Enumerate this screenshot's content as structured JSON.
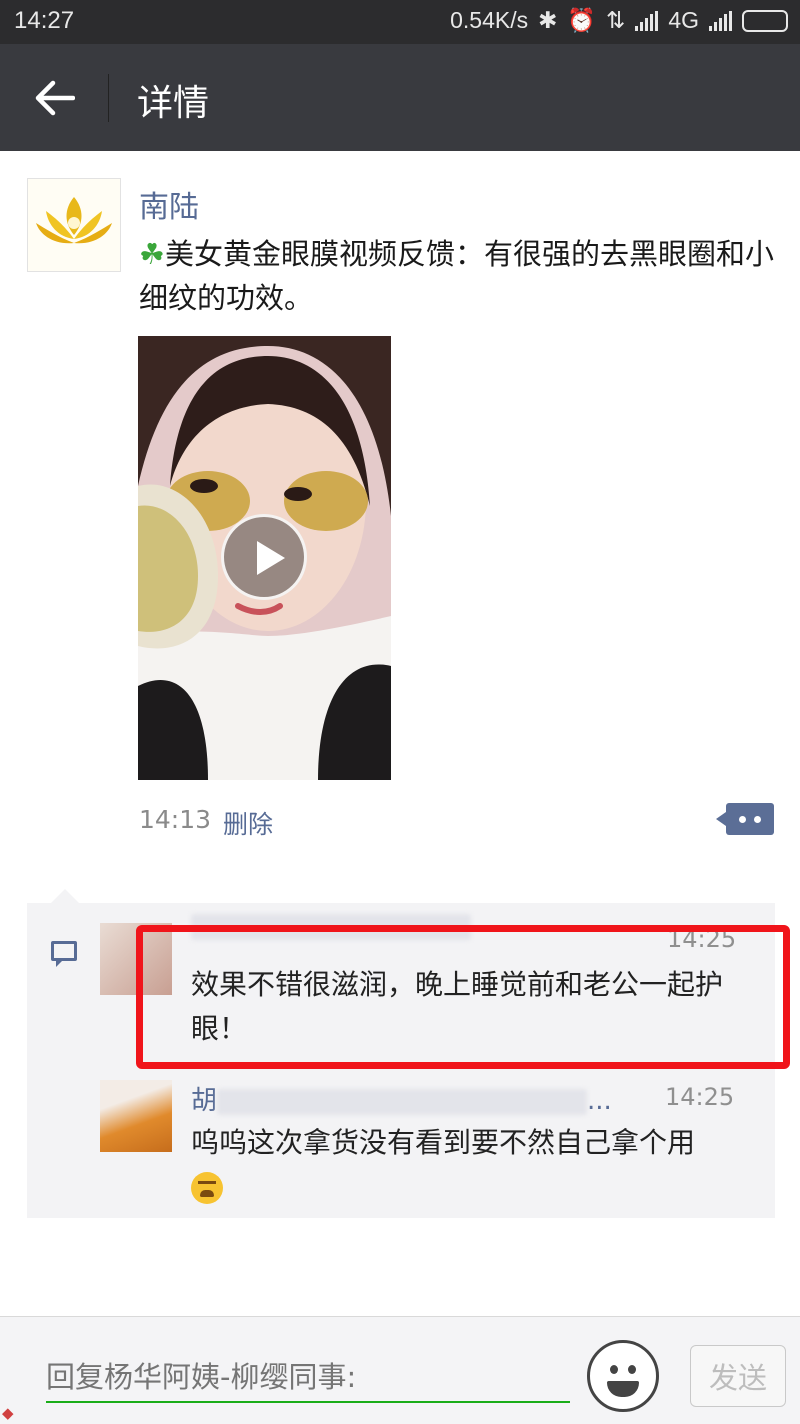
{
  "status_bar": {
    "time": "14:27",
    "network_speed": "0.54K/s",
    "network_type": "4G",
    "battery_color": "#f5a623"
  },
  "app_bar": {
    "back_icon": "arrow-left-icon",
    "title": "详情"
  },
  "post": {
    "author": "南陆",
    "text_icon": "four-leaf-clover",
    "text": "美女黄金眼膜视频反馈：有很强的去黑眼圈和小细纹的功效。",
    "video_play_icon": "play-icon",
    "time": "14:13",
    "delete_label": "删除",
    "more_icon": "more-dots-icon"
  },
  "comments": [
    {
      "time": "14:25",
      "text": "效果不错很滋润，晚上睡觉前和老公一起护眼！",
      "highlighted": true
    },
    {
      "name_visible": "胡",
      "name_suffix": "...",
      "time": "14:25",
      "text": "呜呜这次拿货没有看到要不然自己拿个用",
      "emoji": "crying-face"
    }
  ],
  "reply_bar": {
    "placeholder": "回复杨华阿姨-柳缨同事:",
    "emoji_icon": "smiley-icon",
    "send_label": "发送"
  },
  "colors": {
    "link_blue": "#576b95",
    "highlight_red": "#f0141a",
    "input_underline": "#1aad19"
  }
}
